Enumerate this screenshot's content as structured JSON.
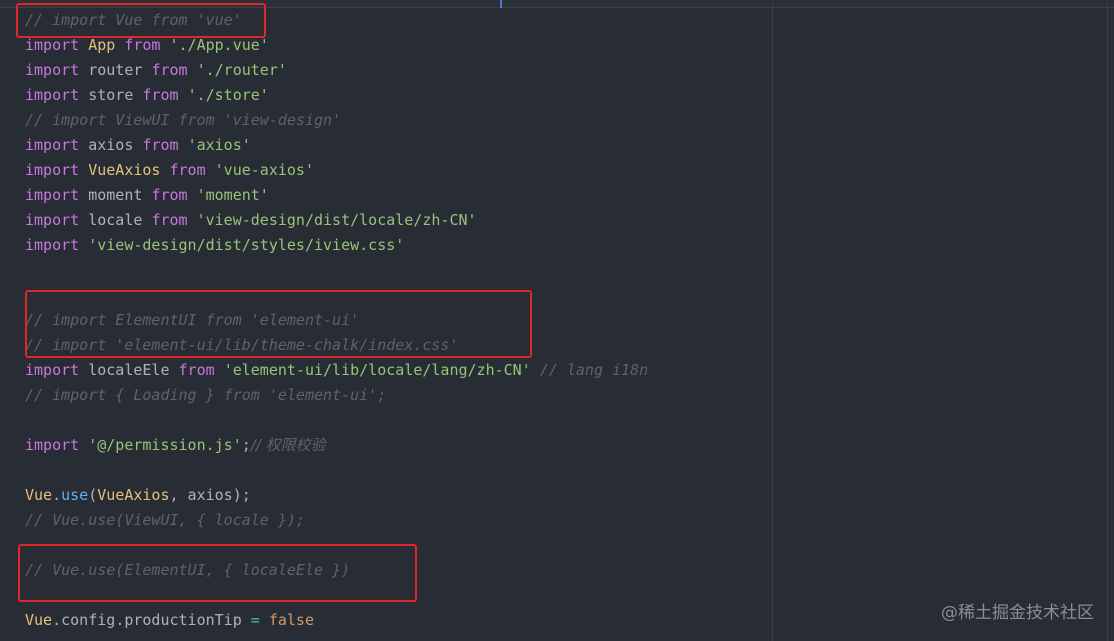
{
  "editor": {
    "lines": [
      {
        "tokens": [
          {
            "t": "cmt",
            "v": "// import Vue from 'vue'"
          }
        ]
      },
      {
        "tokens": [
          {
            "t": "kw",
            "v": "import"
          },
          {
            "t": "ident",
            "v": " "
          },
          {
            "t": "cls",
            "v": "App"
          },
          {
            "t": "ident",
            "v": " "
          },
          {
            "t": "kw",
            "v": "from"
          },
          {
            "t": "ident",
            "v": " "
          },
          {
            "t": "str",
            "v": "'./App.vue'"
          }
        ]
      },
      {
        "tokens": [
          {
            "t": "kw",
            "v": "import"
          },
          {
            "t": "ident",
            "v": " router "
          },
          {
            "t": "kw",
            "v": "from"
          },
          {
            "t": "ident",
            "v": " "
          },
          {
            "t": "str",
            "v": "'./router'"
          }
        ]
      },
      {
        "tokens": [
          {
            "t": "kw",
            "v": "import"
          },
          {
            "t": "ident",
            "v": " store "
          },
          {
            "t": "kw",
            "v": "from"
          },
          {
            "t": "ident",
            "v": " "
          },
          {
            "t": "str",
            "v": "'./store'"
          }
        ]
      },
      {
        "tokens": [
          {
            "t": "cmt",
            "v": "// import ViewUI from 'view-design'"
          }
        ]
      },
      {
        "tokens": [
          {
            "t": "kw",
            "v": "import"
          },
          {
            "t": "ident",
            "v": " axios "
          },
          {
            "t": "kw",
            "v": "from"
          },
          {
            "t": "ident",
            "v": " "
          },
          {
            "t": "str",
            "v": "'axios'"
          }
        ]
      },
      {
        "tokens": [
          {
            "t": "kw",
            "v": "import"
          },
          {
            "t": "ident",
            "v": " "
          },
          {
            "t": "cls",
            "v": "VueAxios"
          },
          {
            "t": "ident",
            "v": " "
          },
          {
            "t": "kw",
            "v": "from"
          },
          {
            "t": "ident",
            "v": " "
          },
          {
            "t": "str",
            "v": "'vue-axios'"
          }
        ]
      },
      {
        "tokens": [
          {
            "t": "kw",
            "v": "import"
          },
          {
            "t": "ident",
            "v": " moment "
          },
          {
            "t": "kw",
            "v": "from"
          },
          {
            "t": "ident",
            "v": " "
          },
          {
            "t": "str",
            "v": "'moment'"
          }
        ]
      },
      {
        "tokens": [
          {
            "t": "kw",
            "v": "import"
          },
          {
            "t": "ident",
            "v": " locale "
          },
          {
            "t": "kw",
            "v": "from"
          },
          {
            "t": "ident",
            "v": " "
          },
          {
            "t": "str",
            "v": "'view-design/dist/locale/zh-CN'"
          }
        ]
      },
      {
        "tokens": [
          {
            "t": "kw",
            "v": "import"
          },
          {
            "t": "ident",
            "v": " "
          },
          {
            "t": "str",
            "v": "'view-design/dist/styles/iview.css'"
          }
        ]
      },
      {
        "tokens": []
      },
      {
        "tokens": []
      },
      {
        "tokens": [
          {
            "t": "cmt",
            "v": "// import ElementUI from 'element-ui'"
          }
        ]
      },
      {
        "tokens": [
          {
            "t": "cmt",
            "v": "// import 'element-ui/lib/theme-chalk/index.css'"
          }
        ]
      },
      {
        "tokens": [
          {
            "t": "kw",
            "v": "import"
          },
          {
            "t": "ident",
            "v": " localeEle "
          },
          {
            "t": "kw",
            "v": "from"
          },
          {
            "t": "ident",
            "v": " "
          },
          {
            "t": "str",
            "v": "'element-ui/lib/locale/lang/zh-CN'"
          },
          {
            "t": "ident",
            "v": " "
          },
          {
            "t": "cmt",
            "v": "// lang i18n"
          }
        ]
      },
      {
        "tokens": [
          {
            "t": "cmt",
            "v": "// import { Loading } from 'element-ui';"
          }
        ]
      },
      {
        "tokens": []
      },
      {
        "tokens": [
          {
            "t": "kw",
            "v": "import"
          },
          {
            "t": "ident",
            "v": " "
          },
          {
            "t": "str",
            "v": "'@/permission.js'"
          },
          {
            "t": "punc",
            "v": ";"
          },
          {
            "t": "cmt",
            "v": "// 权限校验"
          }
        ]
      },
      {
        "tokens": []
      },
      {
        "tokens": [
          {
            "t": "cls",
            "v": "Vue"
          },
          {
            "t": "punc",
            "v": "."
          },
          {
            "t": "fn",
            "v": "use"
          },
          {
            "t": "punc",
            "v": "("
          },
          {
            "t": "cls",
            "v": "VueAxios"
          },
          {
            "t": "punc",
            "v": ", axios);"
          }
        ]
      },
      {
        "tokens": [
          {
            "t": "cmt",
            "v": "// Vue.use(ViewUI, { locale });"
          }
        ]
      },
      {
        "tokens": []
      },
      {
        "tokens": [
          {
            "t": "cmt",
            "v": "// Vue.use(ElementUI, { localeEle })"
          }
        ]
      },
      {
        "tokens": []
      },
      {
        "tokens": [
          {
            "t": "cls",
            "v": "Vue"
          },
          {
            "t": "punc",
            "v": "."
          },
          {
            "t": "ident",
            "v": "config"
          },
          {
            "t": "punc",
            "v": "."
          },
          {
            "t": "ident",
            "v": "productionTip"
          },
          {
            "t": "ident",
            "v": " "
          },
          {
            "t": "op",
            "v": "="
          },
          {
            "t": "ident",
            "v": " "
          },
          {
            "t": "bool",
            "v": "false"
          }
        ]
      }
    ]
  },
  "watermark": "@稀土掘金技术社区",
  "colors": {
    "background": "#282c34",
    "keyword": "#c678dd",
    "string": "#98c379",
    "comment": "#5c6370",
    "class": "#e5c07b",
    "function": "#61afef",
    "highlight_box": "#e0262b"
  }
}
